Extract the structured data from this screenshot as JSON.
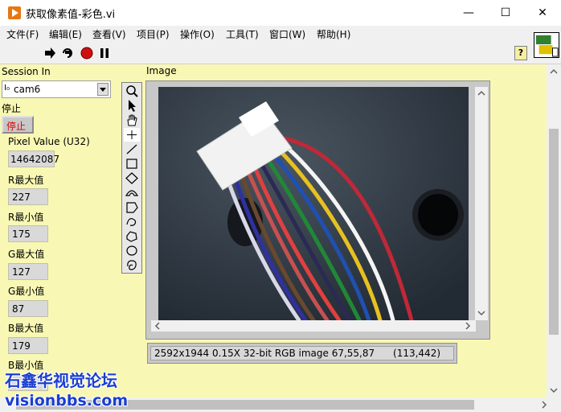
{
  "window": {
    "title": "获取像素值-彩色.vi",
    "minimize": "—",
    "maximize": "☐",
    "close": "✕"
  },
  "menu": [
    {
      "label": "文件(F)"
    },
    {
      "label": "编辑(E)"
    },
    {
      "label": "查看(V)"
    },
    {
      "label": "项目(P)"
    },
    {
      "label": "操作(O)"
    },
    {
      "label": "工具(T)"
    },
    {
      "label": "窗口(W)"
    },
    {
      "label": "帮助(H)"
    }
  ],
  "toolbar": {
    "run": "run-arrow-icon",
    "run_continuous": "run-continuous-icon",
    "abort": "abort-icon",
    "pause": "pause-icon",
    "help_label": "?"
  },
  "session": {
    "label": "Session In",
    "prefix": "I₀",
    "value": "cam6"
  },
  "stop": {
    "label": "停止",
    "button_label": "停止"
  },
  "pixel_value": {
    "label": "Pixel Value (U32)",
    "value": "14642087"
  },
  "indicators": [
    {
      "label": "R最大值",
      "value": "227"
    },
    {
      "label": "R最小值",
      "value": "175"
    },
    {
      "label": "G最大值",
      "value": "127"
    },
    {
      "label": "G最小值",
      "value": "87"
    },
    {
      "label": "B最大值",
      "value": "179"
    },
    {
      "label": "B最小值",
      "value": ""
    }
  ],
  "image_display": {
    "label": "Image",
    "status": "2592x1944 0.15X 32-bit RGB image 67,55,87      (113,442)"
  },
  "tools": [
    "zoom-icon",
    "pointer-icon",
    "pan-hand-icon",
    "crosshair-icon",
    "line-icon",
    "rectangle-icon",
    "rotated-rectangle-icon",
    "annulus-icon",
    "polygon-icon",
    "freehand-icon",
    "broken-line-icon",
    "oval-icon",
    "freehand-region-icon"
  ],
  "watermark": {
    "line1": "石鑫华视觉论坛",
    "line2": "visionbbs.com"
  }
}
